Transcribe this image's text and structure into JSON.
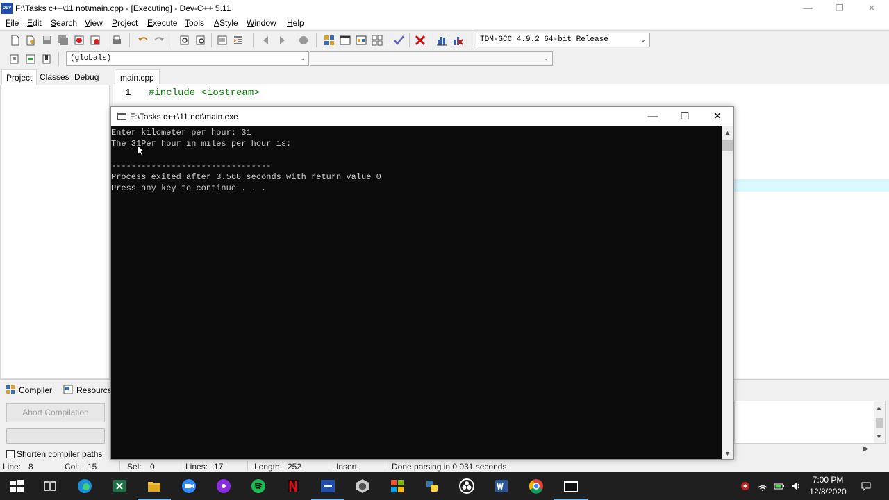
{
  "window": {
    "title": "F:\\Tasks c++\\11 not\\main.cpp - [Executing] - Dev-C++ 5.11",
    "icon_label": "DEV",
    "controls": [
      "—",
      "❐",
      "✕"
    ]
  },
  "menu": [
    "File",
    "Edit",
    "Search",
    "View",
    "Project",
    "Execute",
    "Tools",
    "AStyle",
    "Window",
    "Help"
  ],
  "toolbar": {
    "compiler_select": "TDM-GCC 4.9.2 64-bit Release",
    "globals_select": "(globals)",
    "members_select": ""
  },
  "left_panel": {
    "tabs": [
      "Project",
      "Classes",
      "Debug"
    ],
    "active_tab": "Project"
  },
  "editor": {
    "file_tab": "main.cpp",
    "line_number": "1",
    "code_line": "#include <iostream>"
  },
  "console": {
    "title": "F:\\Tasks c++\\11 not\\main.exe",
    "lines": [
      "Enter kilometer per hour: 31",
      "The 31Per hour in miles per hour is:",
      "",
      "--------------------------------",
      "Process exited after 3.568 seconds with return value 0",
      "Press any key to continue . . ."
    ]
  },
  "bottom_panel": {
    "tabs": [
      "Compiler",
      "Resources"
    ],
    "abort_button": "Abort Compilation",
    "shorten_checkbox": "Shorten compiler paths"
  },
  "status_bar": {
    "line_label": "Line:",
    "line_value": "8",
    "col_label": "Col:",
    "col_value": "15",
    "sel_label": "Sel:",
    "sel_value": "0",
    "lines_label": "Lines:",
    "lines_value": "17",
    "length_label": "Length:",
    "length_value": "252",
    "mode": "Insert",
    "message": "Done parsing in 0.031 seconds"
  },
  "taskbar": {
    "apps": [
      "start-icon",
      "task-view-icon",
      "edge-icon",
      "excel-icon",
      "file-explorer-icon",
      "zoom-icon",
      "podcast-icon",
      "spotify-icon",
      "netflix-icon",
      "devcpp-icon",
      "unity-icon",
      "microsoft-store-icon",
      "python-icon",
      "obs-icon",
      "word-icon",
      "chrome-icon",
      "console-app-icon"
    ],
    "clock_time": "7:00 PM",
    "clock_date": "12/8/2020"
  }
}
